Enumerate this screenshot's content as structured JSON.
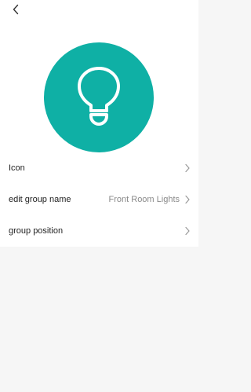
{
  "header": {
    "back_icon": "chevron-left-icon"
  },
  "group_icon": {
    "icon": "lightbulb-icon",
    "background_color": "#0fb0a5"
  },
  "settings": {
    "icon": {
      "label": "Icon"
    },
    "group_name": {
      "label": "edit group name",
      "value": "Front Room Lights"
    },
    "group_position": {
      "label": "group position"
    }
  },
  "colors": {
    "accent": "#0fb0a5",
    "text": "#1f1f1f",
    "muted": "#8a8a8a",
    "background": "#f6f6f6"
  }
}
